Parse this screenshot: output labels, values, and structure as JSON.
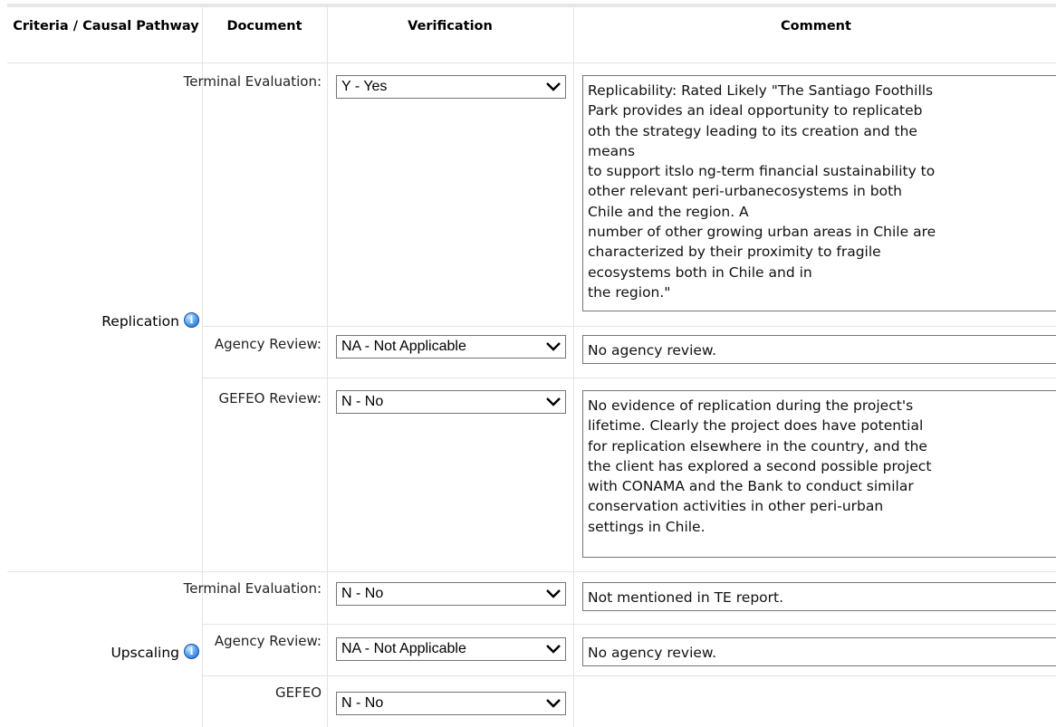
{
  "header": {
    "criteria": "Criteria / Causal Pathway",
    "document": "Document",
    "verification": "Verification",
    "comment": "Comment"
  },
  "sections": [
    {
      "criteria": "Replication",
      "rows": [
        {
          "document": "Terminal Evaluation:",
          "verification": "Y - Yes",
          "comment": "Replicability: Rated Likely \"The Santiago Foothills\nPark provides an ideal opportunity to replicateb\noth the strategy leading to its creation and the\nmeans\nto support itslo ng-term financial sustainability to\nother relevant peri-urbanecosystems in both\nChile and the region. A\nnumber of other growing urban areas in Chile are\ncharacterized by their proximity to fragile\necosystems both in Chile and in\nthe region.\""
        },
        {
          "document": "Agency Review:",
          "verification": "NA - Not Applicable",
          "comment": "No agency review."
        },
        {
          "document": "GEFEO Review:",
          "verification": "N - No",
          "comment": "No evidence of replication during the project's\nlifetime. Clearly the project does have potential\nfor replication elsewhere in the country, and the\nthe client has explored a second possible project\nwith CONAMA and the Bank to conduct similar\nconservation activities in other peri-urban\nsettings in Chile."
        }
      ]
    },
    {
      "criteria": "Upscaling",
      "rows": [
        {
          "document": "Terminal Evaluation:",
          "verification": "N - No",
          "comment": "Not mentioned in TE report."
        },
        {
          "document": "Agency Review:",
          "verification": "NA - Not Applicable",
          "comment": "No agency review."
        },
        {
          "document": "GEFEO",
          "verification": "N - No",
          "comment": ""
        }
      ]
    }
  ],
  "icons": {
    "info": "info-icon",
    "dropdown": "chevron-down-icon"
  }
}
